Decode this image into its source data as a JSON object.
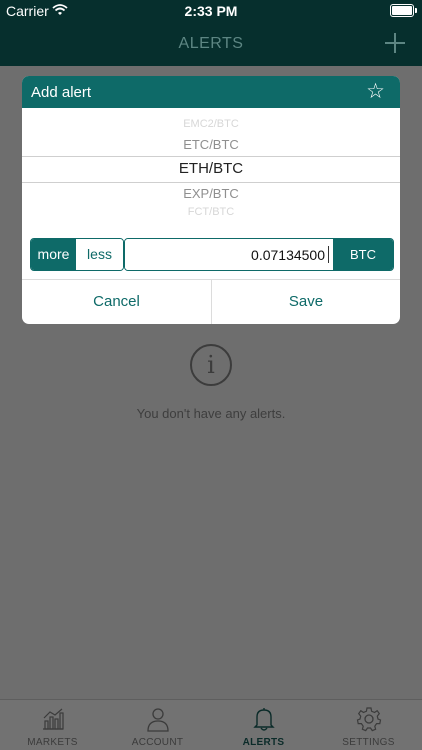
{
  "status_bar": {
    "carrier": "Carrier",
    "time": "2:33 PM"
  },
  "nav": {
    "title": "ALERTS",
    "add_icon": "plus-icon"
  },
  "empty_state": {
    "icon": "info-circle-icon",
    "glyph": "i",
    "message": "You don't have any alerts."
  },
  "dialog": {
    "title": "Add alert",
    "favorite_icon": "star-outline-icon",
    "favorite_glyph": "☆",
    "picker": {
      "items": [
        "EMC2/BTC",
        "ETC/BTC",
        "ETH/BTC",
        "EXP/BTC",
        "FCT/BTC"
      ],
      "selected": "ETH/BTC"
    },
    "more_label": "more",
    "less_label": "less",
    "amount_value": "0.07134500",
    "unit_label": "BTC",
    "cancel_label": "Cancel",
    "save_label": "Save"
  },
  "tabs": [
    {
      "label": "MARKETS",
      "icon": "bar-chart-icon",
      "active": false
    },
    {
      "label": "ACCOUNT",
      "icon": "person-icon",
      "active": false
    },
    {
      "label": "ALERTS",
      "icon": "bell-icon",
      "active": true
    },
    {
      "label": "SETTINGS",
      "icon": "gear-icon",
      "active": false
    }
  ],
  "colors": {
    "accent": "#0e6a68",
    "nav_background": "#062f2d",
    "overlay": "#6e6e6e"
  }
}
